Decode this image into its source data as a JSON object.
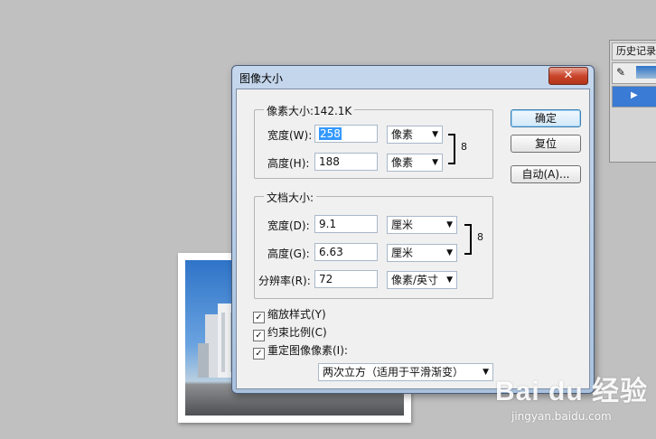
{
  "history_panel": {
    "tab_label": "历史记录"
  },
  "dialog": {
    "title": "图像大小",
    "close_symbol": "✕",
    "pixel_dimensions": {
      "legend": "像素大小:142.1K",
      "width_label": "宽度(W):",
      "width_value": "258",
      "width_unit": "像素",
      "height_label": "高度(H):",
      "height_value": "188",
      "height_unit": "像素"
    },
    "document_size": {
      "legend": "文档大小:",
      "width_label": "宽度(D):",
      "width_value": "9.1",
      "width_unit": "厘米",
      "height_label": "高度(G):",
      "height_value": "6.63",
      "height_unit": "厘米",
      "resolution_label": "分辨率(R):",
      "resolution_value": "72",
      "resolution_unit": "像素/英寸"
    },
    "checkboxes": [
      {
        "label": "缩放样式(Y)",
        "checked": true
      },
      {
        "label": "约束比例(C)",
        "checked": true
      },
      {
        "label": "重定图像像素(I):",
        "checked": true
      }
    ],
    "resample_method": "两次立方（适用于平滑渐变）",
    "buttons": {
      "ok": "确定",
      "reset": "复位",
      "auto": "自动(A)..."
    }
  },
  "watermark": {
    "brand": "Bai du 经验",
    "url": "jingyan.baidu.com"
  },
  "icons": {
    "check": "✓",
    "dropdown_arrow": "▼",
    "chain_link": "8"
  }
}
